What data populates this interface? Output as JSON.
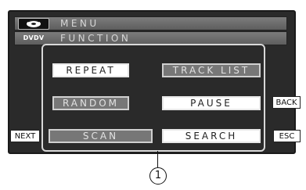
{
  "header": {
    "menu_title": "MENU",
    "source_label": "DVDV",
    "function_title": "FUNCTION"
  },
  "buttons": {
    "repeat": "REPEAT",
    "track_list": "TRACK LIST",
    "random": "RANDOM",
    "pause": "PAUSE",
    "scan": "SCAN",
    "search": "SEARCH"
  },
  "side": {
    "back": "BACK",
    "next": "NEXT",
    "esc": "ESC"
  },
  "callout": {
    "number": "1"
  },
  "icons": {
    "disc": "disc-icon"
  },
  "colors": {
    "screen": "#2a2a2a",
    "button_active": "#ffffff",
    "button_inactive": "#777777"
  }
}
